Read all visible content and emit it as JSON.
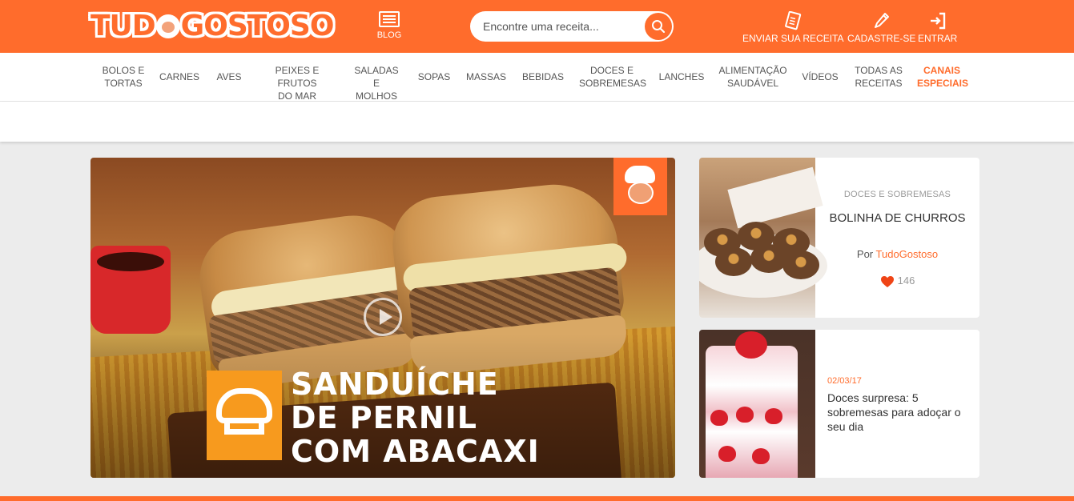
{
  "header": {
    "logo_text_left": "TUD",
    "logo_text_right": "GOSTOSO",
    "blog_label": "BLOG",
    "search_placeholder": "Encontre uma receita...",
    "send_recipe_label": "ENVIAR SUA RECEITA",
    "register_label": "CADASTRE-SE",
    "login_label": "ENTRAR",
    "accent_color": "#ff6c2c"
  },
  "categories": [
    {
      "l1": "BOLOS E",
      "l2": "TORTAS"
    },
    {
      "l1": "CARNES",
      "l2": ""
    },
    {
      "l1": "AVES",
      "l2": ""
    },
    {
      "l1": "PEIXES E FRUTOS",
      "l2": "DO MAR"
    },
    {
      "l1": "SALADAS E",
      "l2": "MOLHOS"
    },
    {
      "l1": "SOPAS",
      "l2": ""
    },
    {
      "l1": "MASSAS",
      "l2": ""
    },
    {
      "l1": "BEBIDAS",
      "l2": ""
    },
    {
      "l1": "DOCES E",
      "l2": "SOBREMESAS"
    },
    {
      "l1": "LANCHES",
      "l2": ""
    },
    {
      "l1": "ALIMENTAÇÃO",
      "l2": "SAUDÁVEL"
    },
    {
      "l1": "VÍDEOS",
      "l2": ""
    },
    {
      "l1": "TODAS AS",
      "l2": "RECEITAS"
    },
    {
      "l1": "CANAIS",
      "l2": "ESPECIAIS"
    }
  ],
  "hero": {
    "title_line1": "SANDUÍCHE",
    "title_line2": "DE PERNIL",
    "title_line3": "COM ABACAXI",
    "icon": "play-icon"
  },
  "card1": {
    "category": "DOCES E SOBREMESAS",
    "title": "BOLINHA DE CHURROS",
    "by_prefix": "Por",
    "author": "TudoGostoso",
    "likes": "146"
  },
  "card2": {
    "date": "02/03/17",
    "title": "Doces surpresa: 5 sobremesas para adoçar o seu dia"
  }
}
